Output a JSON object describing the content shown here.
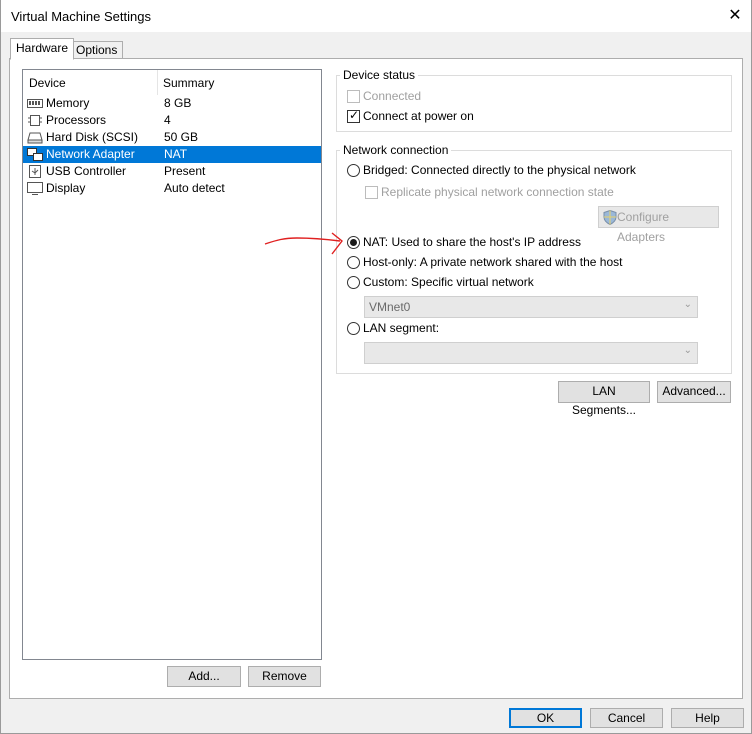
{
  "window": {
    "title": "Virtual Machine Settings"
  },
  "tabs": [
    {
      "label": "Hardware",
      "active": true
    },
    {
      "label": "Options",
      "active": false
    }
  ],
  "device_list": {
    "headers": {
      "device": "Device",
      "summary": "Summary"
    },
    "items": [
      {
        "name": "Memory",
        "summary": "8 GB",
        "icon": "memory-icon",
        "selected": false
      },
      {
        "name": "Processors",
        "summary": "4",
        "icon": "processor-icon",
        "selected": false
      },
      {
        "name": "Hard Disk (SCSI)",
        "summary": "50 GB",
        "icon": "hard-disk-icon",
        "selected": false
      },
      {
        "name": "Network Adapter",
        "summary": "NAT",
        "icon": "network-adapter-icon",
        "selected": true
      },
      {
        "name": "USB Controller",
        "summary": "Present",
        "icon": "usb-icon",
        "selected": false
      },
      {
        "name": "Display",
        "summary": "Auto detect",
        "icon": "display-icon",
        "selected": false
      }
    ]
  },
  "list_buttons": {
    "add": "Add...",
    "remove": "Remove"
  },
  "device_status": {
    "title": "Device status",
    "connected": {
      "label": "Connected",
      "checked": false,
      "enabled": false
    },
    "connect_on_power": {
      "label": "Connect at power on",
      "checked": true,
      "enabled": true
    }
  },
  "network_connection": {
    "title": "Network connection",
    "bridged": {
      "label": "Bridged: Connected directly to the physical network",
      "selected": false
    },
    "replicate": {
      "label": "Replicate physical network connection state",
      "checked": false,
      "enabled": false
    },
    "configure_adapters": "Configure Adapters",
    "nat": {
      "label": "NAT: Used to share the host's IP address",
      "selected": true
    },
    "host_only": {
      "label": "Host-only: A private network shared with the host",
      "selected": false
    },
    "custom": {
      "label": "Custom: Specific virtual network",
      "selected": false
    },
    "custom_select": {
      "value": "VMnet0"
    },
    "lan_segment": {
      "label": "LAN segment:",
      "selected": false
    },
    "lan_select": {
      "value": ""
    }
  },
  "panel_buttons": {
    "lan_segments": "LAN Segments...",
    "advanced": "Advanced..."
  },
  "footer_buttons": {
    "ok": "OK",
    "cancel": "Cancel",
    "help": "Help"
  },
  "colors": {
    "selection": "#0078d7",
    "annotation_arrow": "#e02020"
  }
}
